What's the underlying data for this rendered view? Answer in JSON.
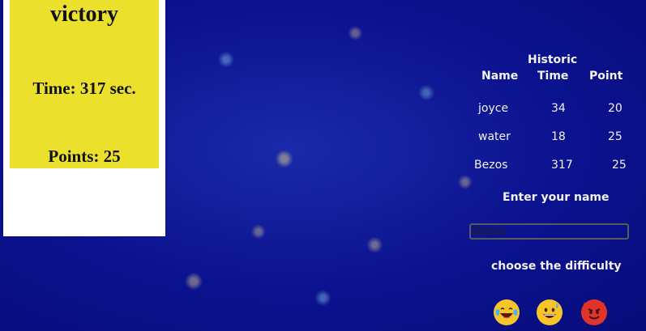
{
  "result": {
    "title": "victory",
    "time": "Time: 317 sec.",
    "points": "Points: 25"
  },
  "historic": {
    "caption": "Historic",
    "headers": {
      "name": "Name",
      "time": "Time",
      "point": "Point"
    },
    "rows": [
      {
        "name": "joyce",
        "time": "34",
        "point": "20"
      },
      {
        "name": "water",
        "time": "18",
        "point": "25"
      },
      {
        "name": "Bezos",
        "time": "317",
        "point": "25"
      }
    ]
  },
  "name_entry": {
    "label": "Enter your name",
    "value": "Bezos"
  },
  "difficulty": {
    "label": "choose the difficulty",
    "options": [
      {
        "icon": "laughing-tears-emoji-icon"
      },
      {
        "icon": "grinning-sweat-emoji-icon"
      },
      {
        "icon": "devil-emoji-icon"
      }
    ]
  },
  "colors": {
    "background": "#0a0f8a",
    "result_yellow": "#ebe12c",
    "text_light": "#f2f2f2"
  }
}
